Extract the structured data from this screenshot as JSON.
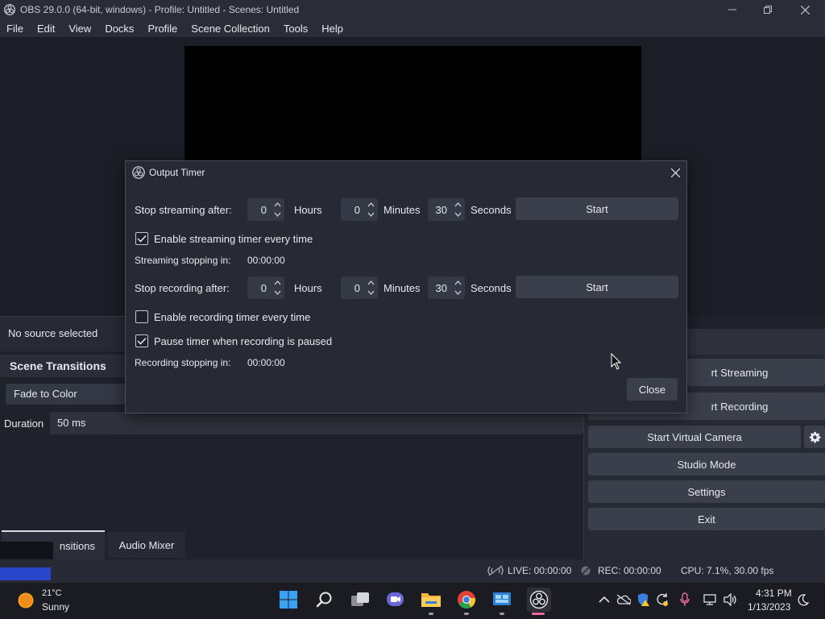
{
  "window": {
    "title": "OBS 29.0.0 (64-bit, windows) - Profile: Untitled - Scenes: Untitled"
  },
  "menu": [
    "File",
    "Edit",
    "View",
    "Docks",
    "Profile",
    "Scene Collection",
    "Tools",
    "Help"
  ],
  "sources": {
    "no_source": "No source selected"
  },
  "scene_transitions": {
    "title": "Scene Transitions",
    "selected": "Fade to Color",
    "duration_label": "Duration",
    "duration_value": "50 ms"
  },
  "controls": {
    "start_streaming": "rt Streaming",
    "start_recording": "rt Recording",
    "start_virtual_camera": "Start Virtual Camera",
    "studio_mode": "Studio Mode",
    "settings": "Settings",
    "exit": "Exit"
  },
  "tabs": {
    "transitions": "nsitions",
    "audio_mixer": "Audio Mixer"
  },
  "status": {
    "live": "LIVE: 00:00:00",
    "rec": "REC: 00:00:00",
    "cpu": "CPU: 7.1%, 30.00 fps"
  },
  "dialog": {
    "title": "Output Timer",
    "stream_label": "Stop streaming after:",
    "stream_hours": "0",
    "stream_minutes": "0",
    "stream_seconds": "30",
    "hours_label": "Hours",
    "minutes_label": "Minutes",
    "seconds_label": "Seconds",
    "start_label": "Start",
    "stream_enable_label": "Enable streaming timer every time",
    "stream_enable_checked": true,
    "stream_stopping": "Streaming stopping in:",
    "stream_stopping_value": "00:00:00",
    "record_label": "Stop recording after:",
    "record_hours": "0",
    "record_minutes": "0",
    "record_seconds": "30",
    "record_enable_label": "Enable recording timer every time",
    "record_enable_checked": false,
    "pause_label": "Pause timer when recording is paused",
    "pause_checked": true,
    "record_stopping": "Recording stopping in:",
    "record_stopping_value": "00:00:00",
    "close_label": "Close"
  },
  "taskbar": {
    "weather_temp": "21°C",
    "weather_desc": "Sunny",
    "time": "4:31 PM",
    "date": "1/13/2023"
  },
  "colors": {
    "background": "#1f212b",
    "panel": "#272a34",
    "button": "#3b3e4b",
    "accent_blue": "#2846c9"
  }
}
